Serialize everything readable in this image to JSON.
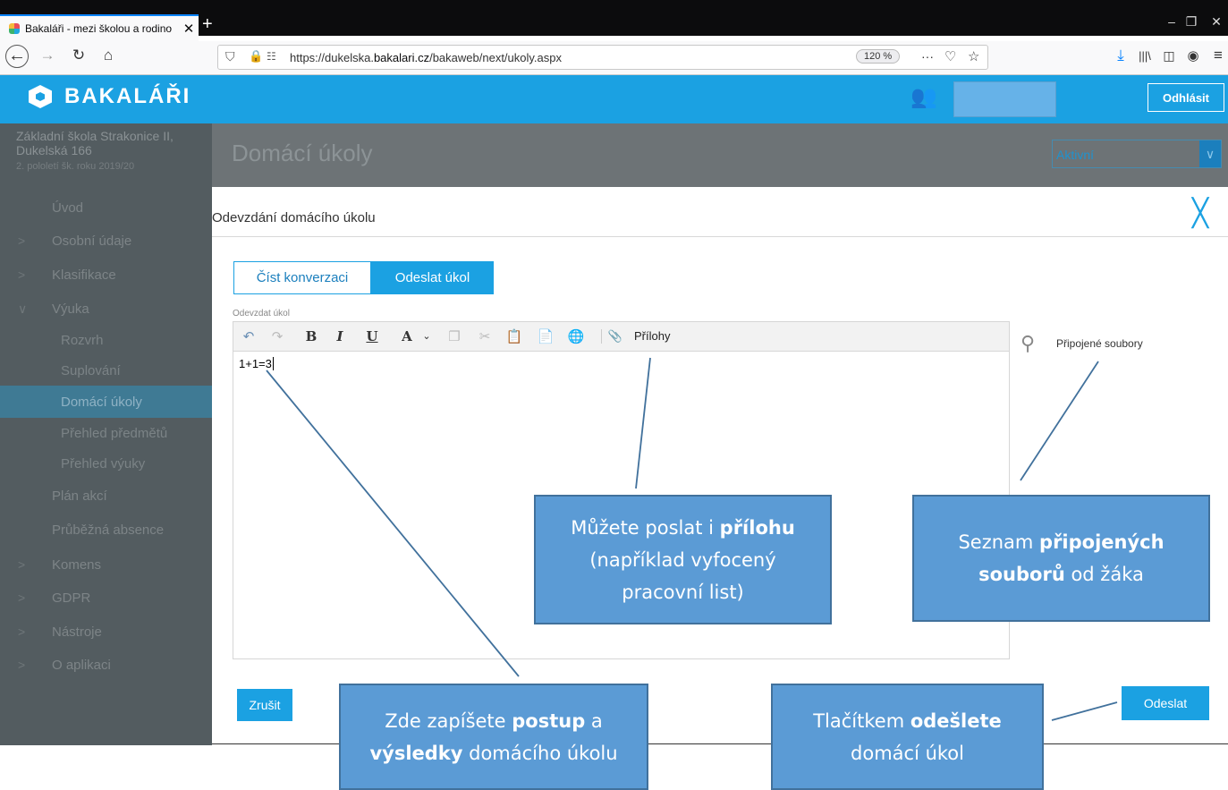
{
  "browser": {
    "tab_title": "Bakaláři - mezi školou a rodino",
    "tab_close": "✕",
    "new_tab": "+",
    "window_controls": [
      "–",
      "❐",
      "✕"
    ],
    "url_prefix": "https://dukelska.",
    "url_domain": "bakalari.cz",
    "url_path": "/bakaweb/next/ukoly.aspx",
    "zoom": "120 %",
    "icons": [
      "back-icon",
      "forward-icon",
      "reload-icon",
      "home-icon",
      "shield-icon",
      "lock-icon",
      "more-icon",
      "pocket-icon",
      "bookmark-star-icon",
      "download-icon",
      "library-icon",
      "sidebar-icon",
      "account-icon",
      "menu-icon"
    ]
  },
  "app": {
    "brand": "BAKALÁŘI",
    "logout": "Odhlásit",
    "brand_color": "#1ba1e2"
  },
  "sidebar": {
    "school_line1": "Základní škola Strakonice II,",
    "school_line2": "Dukelská 166",
    "school_term": "2. pololetí šk. roku 2019/20",
    "items": [
      {
        "label": "Úvod",
        "chevron": ""
      },
      {
        "label": "Osobní údaje",
        "chevron": ">"
      },
      {
        "label": "Klasifikace",
        "chevron": ">"
      },
      {
        "label": "Výuka",
        "chevron": "∨"
      },
      {
        "label": "Rozvrh",
        "sub": true
      },
      {
        "label": "Suplování",
        "sub": true
      },
      {
        "label": "Domácí úkoly",
        "sub": true,
        "active": true
      },
      {
        "label": "Přehled předmětů",
        "sub": true
      },
      {
        "label": "Přehled výuky",
        "sub": true
      },
      {
        "label": "Plán akcí",
        "chevron": ""
      },
      {
        "label": "Průběžná absence",
        "chevron": ""
      },
      {
        "label": "Komens",
        "chevron": ">"
      },
      {
        "label": "GDPR",
        "chevron": ">"
      },
      {
        "label": "Nástroje",
        "chevron": ">"
      },
      {
        "label": "O aplikaci",
        "chevron": ">"
      }
    ]
  },
  "page": {
    "title": "Domácí úkoly",
    "filter_value": "Aktivní",
    "filter_arrow": "∨"
  },
  "modal": {
    "title": "Odevzdání domácího úkolu",
    "close": "╳",
    "tab_read": "Číst konverzaci",
    "tab_send": "Odeslat úkol",
    "editor_label": "Odevzdat úkol",
    "toolbar_attach": "Přílohy",
    "editor_text": "1+1=3",
    "attached_label": "Připojené soubory",
    "cancel": "Zrušit",
    "send": "Odeslat"
  },
  "callouts": {
    "attachment": {
      "pre": "Můžete poslat i ",
      "bold": "přílohu",
      "post": "(například vyfocený pracovní list)"
    },
    "files": {
      "pre": "Seznam ",
      "bold": "připojených souborů",
      "post": " od žáka"
    },
    "procedure": {
      "pre": "Zde zapíšete ",
      "bold1": "postup",
      "mid": " a",
      "bold2": "výsledky",
      "post": " domácího úkolu"
    },
    "send": {
      "pre": "Tlačítkem ",
      "bold": "odešlete",
      "post": "domácí úkol"
    }
  }
}
